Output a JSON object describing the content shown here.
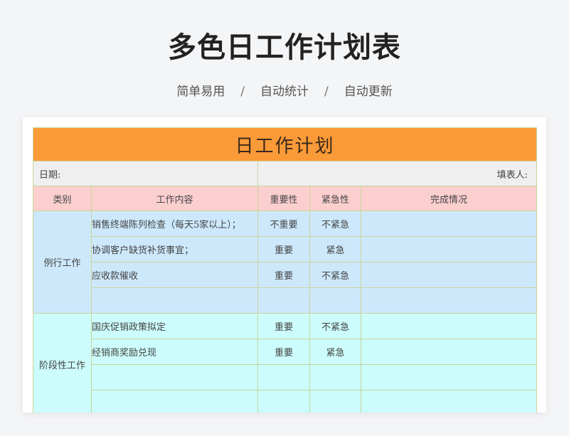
{
  "header": {
    "title": "多色日工作计划表",
    "taglines": [
      "简单易用",
      "自动统计",
      "自动更新"
    ],
    "separator": "/"
  },
  "sheet": {
    "title": "日工作计划",
    "date_label": "日期:",
    "filler_label": "填表人:",
    "columns": [
      "类别",
      "工作内容",
      "重要性",
      "紧急性",
      "完成情况"
    ],
    "groups": [
      {
        "category": "例行工作",
        "color": "#cde8fb",
        "rows": [
          {
            "content": "销售终端陈列检查（每天5家以上）；",
            "importance": "不重要",
            "urgency": "不紧急",
            "status": ""
          },
          {
            "content": "协调客户缺货补货事宜；",
            "importance": "重要",
            "urgency": "紧急",
            "status": ""
          },
          {
            "content": "应收款催收",
            "importance": "重要",
            "urgency": "不紧急",
            "status": ""
          },
          {
            "content": "",
            "importance": "",
            "urgency": "",
            "status": ""
          }
        ]
      },
      {
        "category": "阶段性工作",
        "color": "#cdfcfc",
        "rows": [
          {
            "content": "国庆促销政策拟定",
            "importance": "重要",
            "urgency": "不紧急",
            "status": ""
          },
          {
            "content": "经销商奖励兑现",
            "importance": "重要",
            "urgency": "紧急",
            "status": ""
          },
          {
            "content": "",
            "importance": "",
            "urgency": "",
            "status": ""
          },
          {
            "content": "",
            "importance": "",
            "urgency": "",
            "status": ""
          }
        ]
      }
    ]
  },
  "colors": {
    "title_bar": "#fb9a38",
    "header_row": "#fccfcf",
    "meta_row": "#efefef",
    "border": "#c8d59a"
  }
}
